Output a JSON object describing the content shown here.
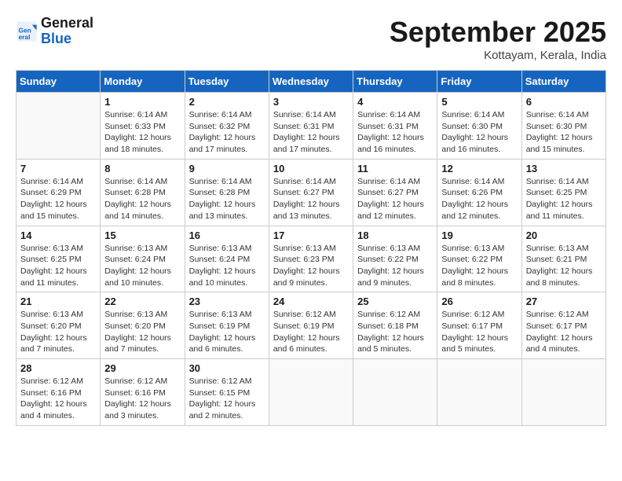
{
  "logo": {
    "line1": "General",
    "line2": "Blue"
  },
  "title": "September 2025",
  "location": "Kottayam, Kerala, India",
  "weekdays": [
    "Sunday",
    "Monday",
    "Tuesday",
    "Wednesday",
    "Thursday",
    "Friday",
    "Saturday"
  ],
  "weeks": [
    [
      {
        "day": "",
        "info": ""
      },
      {
        "day": "1",
        "info": "Sunrise: 6:14 AM\nSunset: 6:33 PM\nDaylight: 12 hours\nand 18 minutes."
      },
      {
        "day": "2",
        "info": "Sunrise: 6:14 AM\nSunset: 6:32 PM\nDaylight: 12 hours\nand 17 minutes."
      },
      {
        "day": "3",
        "info": "Sunrise: 6:14 AM\nSunset: 6:31 PM\nDaylight: 12 hours\nand 17 minutes."
      },
      {
        "day": "4",
        "info": "Sunrise: 6:14 AM\nSunset: 6:31 PM\nDaylight: 12 hours\nand 16 minutes."
      },
      {
        "day": "5",
        "info": "Sunrise: 6:14 AM\nSunset: 6:30 PM\nDaylight: 12 hours\nand 16 minutes."
      },
      {
        "day": "6",
        "info": "Sunrise: 6:14 AM\nSunset: 6:30 PM\nDaylight: 12 hours\nand 15 minutes."
      }
    ],
    [
      {
        "day": "7",
        "info": "Sunrise: 6:14 AM\nSunset: 6:29 PM\nDaylight: 12 hours\nand 15 minutes."
      },
      {
        "day": "8",
        "info": "Sunrise: 6:14 AM\nSunset: 6:28 PM\nDaylight: 12 hours\nand 14 minutes."
      },
      {
        "day": "9",
        "info": "Sunrise: 6:14 AM\nSunset: 6:28 PM\nDaylight: 12 hours\nand 13 minutes."
      },
      {
        "day": "10",
        "info": "Sunrise: 6:14 AM\nSunset: 6:27 PM\nDaylight: 12 hours\nand 13 minutes."
      },
      {
        "day": "11",
        "info": "Sunrise: 6:14 AM\nSunset: 6:27 PM\nDaylight: 12 hours\nand 12 minutes."
      },
      {
        "day": "12",
        "info": "Sunrise: 6:14 AM\nSunset: 6:26 PM\nDaylight: 12 hours\nand 12 minutes."
      },
      {
        "day": "13",
        "info": "Sunrise: 6:14 AM\nSunset: 6:25 PM\nDaylight: 12 hours\nand 11 minutes."
      }
    ],
    [
      {
        "day": "14",
        "info": "Sunrise: 6:13 AM\nSunset: 6:25 PM\nDaylight: 12 hours\nand 11 minutes."
      },
      {
        "day": "15",
        "info": "Sunrise: 6:13 AM\nSunset: 6:24 PM\nDaylight: 12 hours\nand 10 minutes."
      },
      {
        "day": "16",
        "info": "Sunrise: 6:13 AM\nSunset: 6:24 PM\nDaylight: 12 hours\nand 10 minutes."
      },
      {
        "day": "17",
        "info": "Sunrise: 6:13 AM\nSunset: 6:23 PM\nDaylight: 12 hours\nand 9 minutes."
      },
      {
        "day": "18",
        "info": "Sunrise: 6:13 AM\nSunset: 6:22 PM\nDaylight: 12 hours\nand 9 minutes."
      },
      {
        "day": "19",
        "info": "Sunrise: 6:13 AM\nSunset: 6:22 PM\nDaylight: 12 hours\nand 8 minutes."
      },
      {
        "day": "20",
        "info": "Sunrise: 6:13 AM\nSunset: 6:21 PM\nDaylight: 12 hours\nand 8 minutes."
      }
    ],
    [
      {
        "day": "21",
        "info": "Sunrise: 6:13 AM\nSunset: 6:20 PM\nDaylight: 12 hours\nand 7 minutes."
      },
      {
        "day": "22",
        "info": "Sunrise: 6:13 AM\nSunset: 6:20 PM\nDaylight: 12 hours\nand 7 minutes."
      },
      {
        "day": "23",
        "info": "Sunrise: 6:13 AM\nSunset: 6:19 PM\nDaylight: 12 hours\nand 6 minutes."
      },
      {
        "day": "24",
        "info": "Sunrise: 6:12 AM\nSunset: 6:19 PM\nDaylight: 12 hours\nand 6 minutes."
      },
      {
        "day": "25",
        "info": "Sunrise: 6:12 AM\nSunset: 6:18 PM\nDaylight: 12 hours\nand 5 minutes."
      },
      {
        "day": "26",
        "info": "Sunrise: 6:12 AM\nSunset: 6:17 PM\nDaylight: 12 hours\nand 5 minutes."
      },
      {
        "day": "27",
        "info": "Sunrise: 6:12 AM\nSunset: 6:17 PM\nDaylight: 12 hours\nand 4 minutes."
      }
    ],
    [
      {
        "day": "28",
        "info": "Sunrise: 6:12 AM\nSunset: 6:16 PM\nDaylight: 12 hours\nand 4 minutes."
      },
      {
        "day": "29",
        "info": "Sunrise: 6:12 AM\nSunset: 6:16 PM\nDaylight: 12 hours\nand 3 minutes."
      },
      {
        "day": "30",
        "info": "Sunrise: 6:12 AM\nSunset: 6:15 PM\nDaylight: 12 hours\nand 2 minutes."
      },
      {
        "day": "",
        "info": ""
      },
      {
        "day": "",
        "info": ""
      },
      {
        "day": "",
        "info": ""
      },
      {
        "day": "",
        "info": ""
      }
    ]
  ]
}
